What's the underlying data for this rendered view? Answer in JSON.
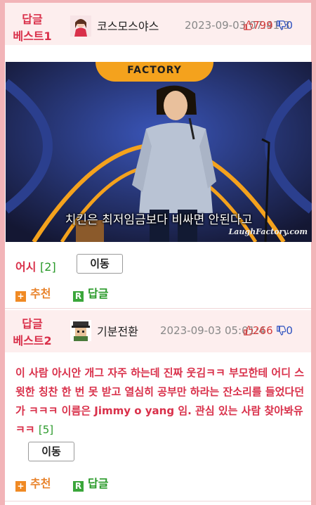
{
  "posts": [
    {
      "best_label": [
        "답글",
        "베스트1"
      ],
      "nickname": "코스모스야스",
      "datetime": "2023-09-03 07:41:3",
      "likes_up": "799",
      "likes_down": "0",
      "title": "어시",
      "reply_count": "[2]",
      "move_label": "이동",
      "recommend_label": "추천",
      "reply_label": "답글",
      "photo": {
        "sign_text": "FACTORY",
        "caption": "치킨은 최저임금보다 비싸면 안된다고",
        "watermark": "LaughFactory.com"
      }
    },
    {
      "best_label": [
        "답글",
        "베스트2"
      ],
      "nickname": "기분전환",
      "datetime": "2023-09-03 05:01:4",
      "likes_up": "266",
      "likes_down": "0",
      "body": "이 사람 아시안 개그 자주 하는데 진짜 웃김ㅋㅋ 부모한테 어디 스윗한 칭찬 한 번 못 받고 열심히 공부만 하라는 잔소리를 들었다던가 ㅋㅋㅋ 이름은 Jimmy o yang 임. 관심 있는 사람 찾아봐유 ㅋㅋ",
      "reply_count": "[5]",
      "move_label": "이동",
      "recommend_label": "추천",
      "reply_label": "답글"
    }
  ],
  "colors": {
    "border": "#f2b4b8",
    "header_bg": "#fdeeee",
    "accent_red": "#d9304a",
    "count_green": "#2a9a2a",
    "recommend_orange": "#e8822a",
    "down_blue": "#2a4fbf"
  }
}
